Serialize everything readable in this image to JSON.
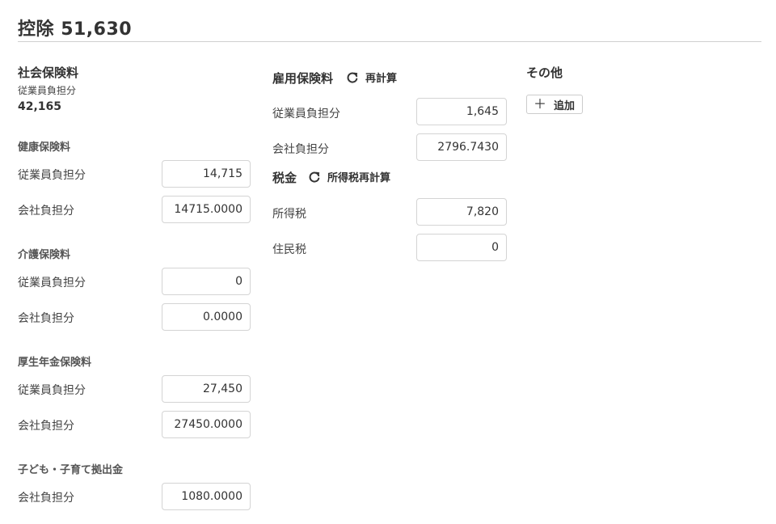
{
  "deduction": {
    "title": "控除",
    "total": "51,630"
  },
  "social_insurance": {
    "title": "社会保険料",
    "employee_label": "従業員負担分",
    "employee_total": "42,165",
    "health": {
      "title": "健康保険料",
      "employee_label": "従業員負担分",
      "employee_value": "14,715",
      "company_label": "会社負担分",
      "company_value": "14715.0000"
    },
    "nursing": {
      "title": "介護保険料",
      "employee_label": "従業員負担分",
      "employee_value": "0",
      "company_label": "会社負担分",
      "company_value": "0.0000"
    },
    "pension": {
      "title": "厚生年金保険料",
      "employee_label": "従業員負担分",
      "employee_value": "27,450",
      "company_label": "会社負担分",
      "company_value": "27450.0000"
    },
    "child": {
      "title": "子ども・子育て拠出金",
      "company_label": "会社負担分",
      "company_value": "1080.0000"
    }
  },
  "employment_insurance": {
    "title": "雇用保険料",
    "recalc_label": "再計算",
    "recalc_icon": "refresh-icon",
    "employee_label": "従業員負担分",
    "employee_value": "1,645",
    "company_label": "会社負担分",
    "company_value": "2796.7430"
  },
  "tax": {
    "title": "税金",
    "recalc_label": "所得税再計算",
    "recalc_icon": "refresh-icon",
    "income_label": "所得税",
    "income_value": "7,820",
    "resident_label": "住民税",
    "resident_value": "0"
  },
  "other": {
    "title": "その他",
    "add_label": "追加",
    "add_icon": "plus-icon"
  }
}
